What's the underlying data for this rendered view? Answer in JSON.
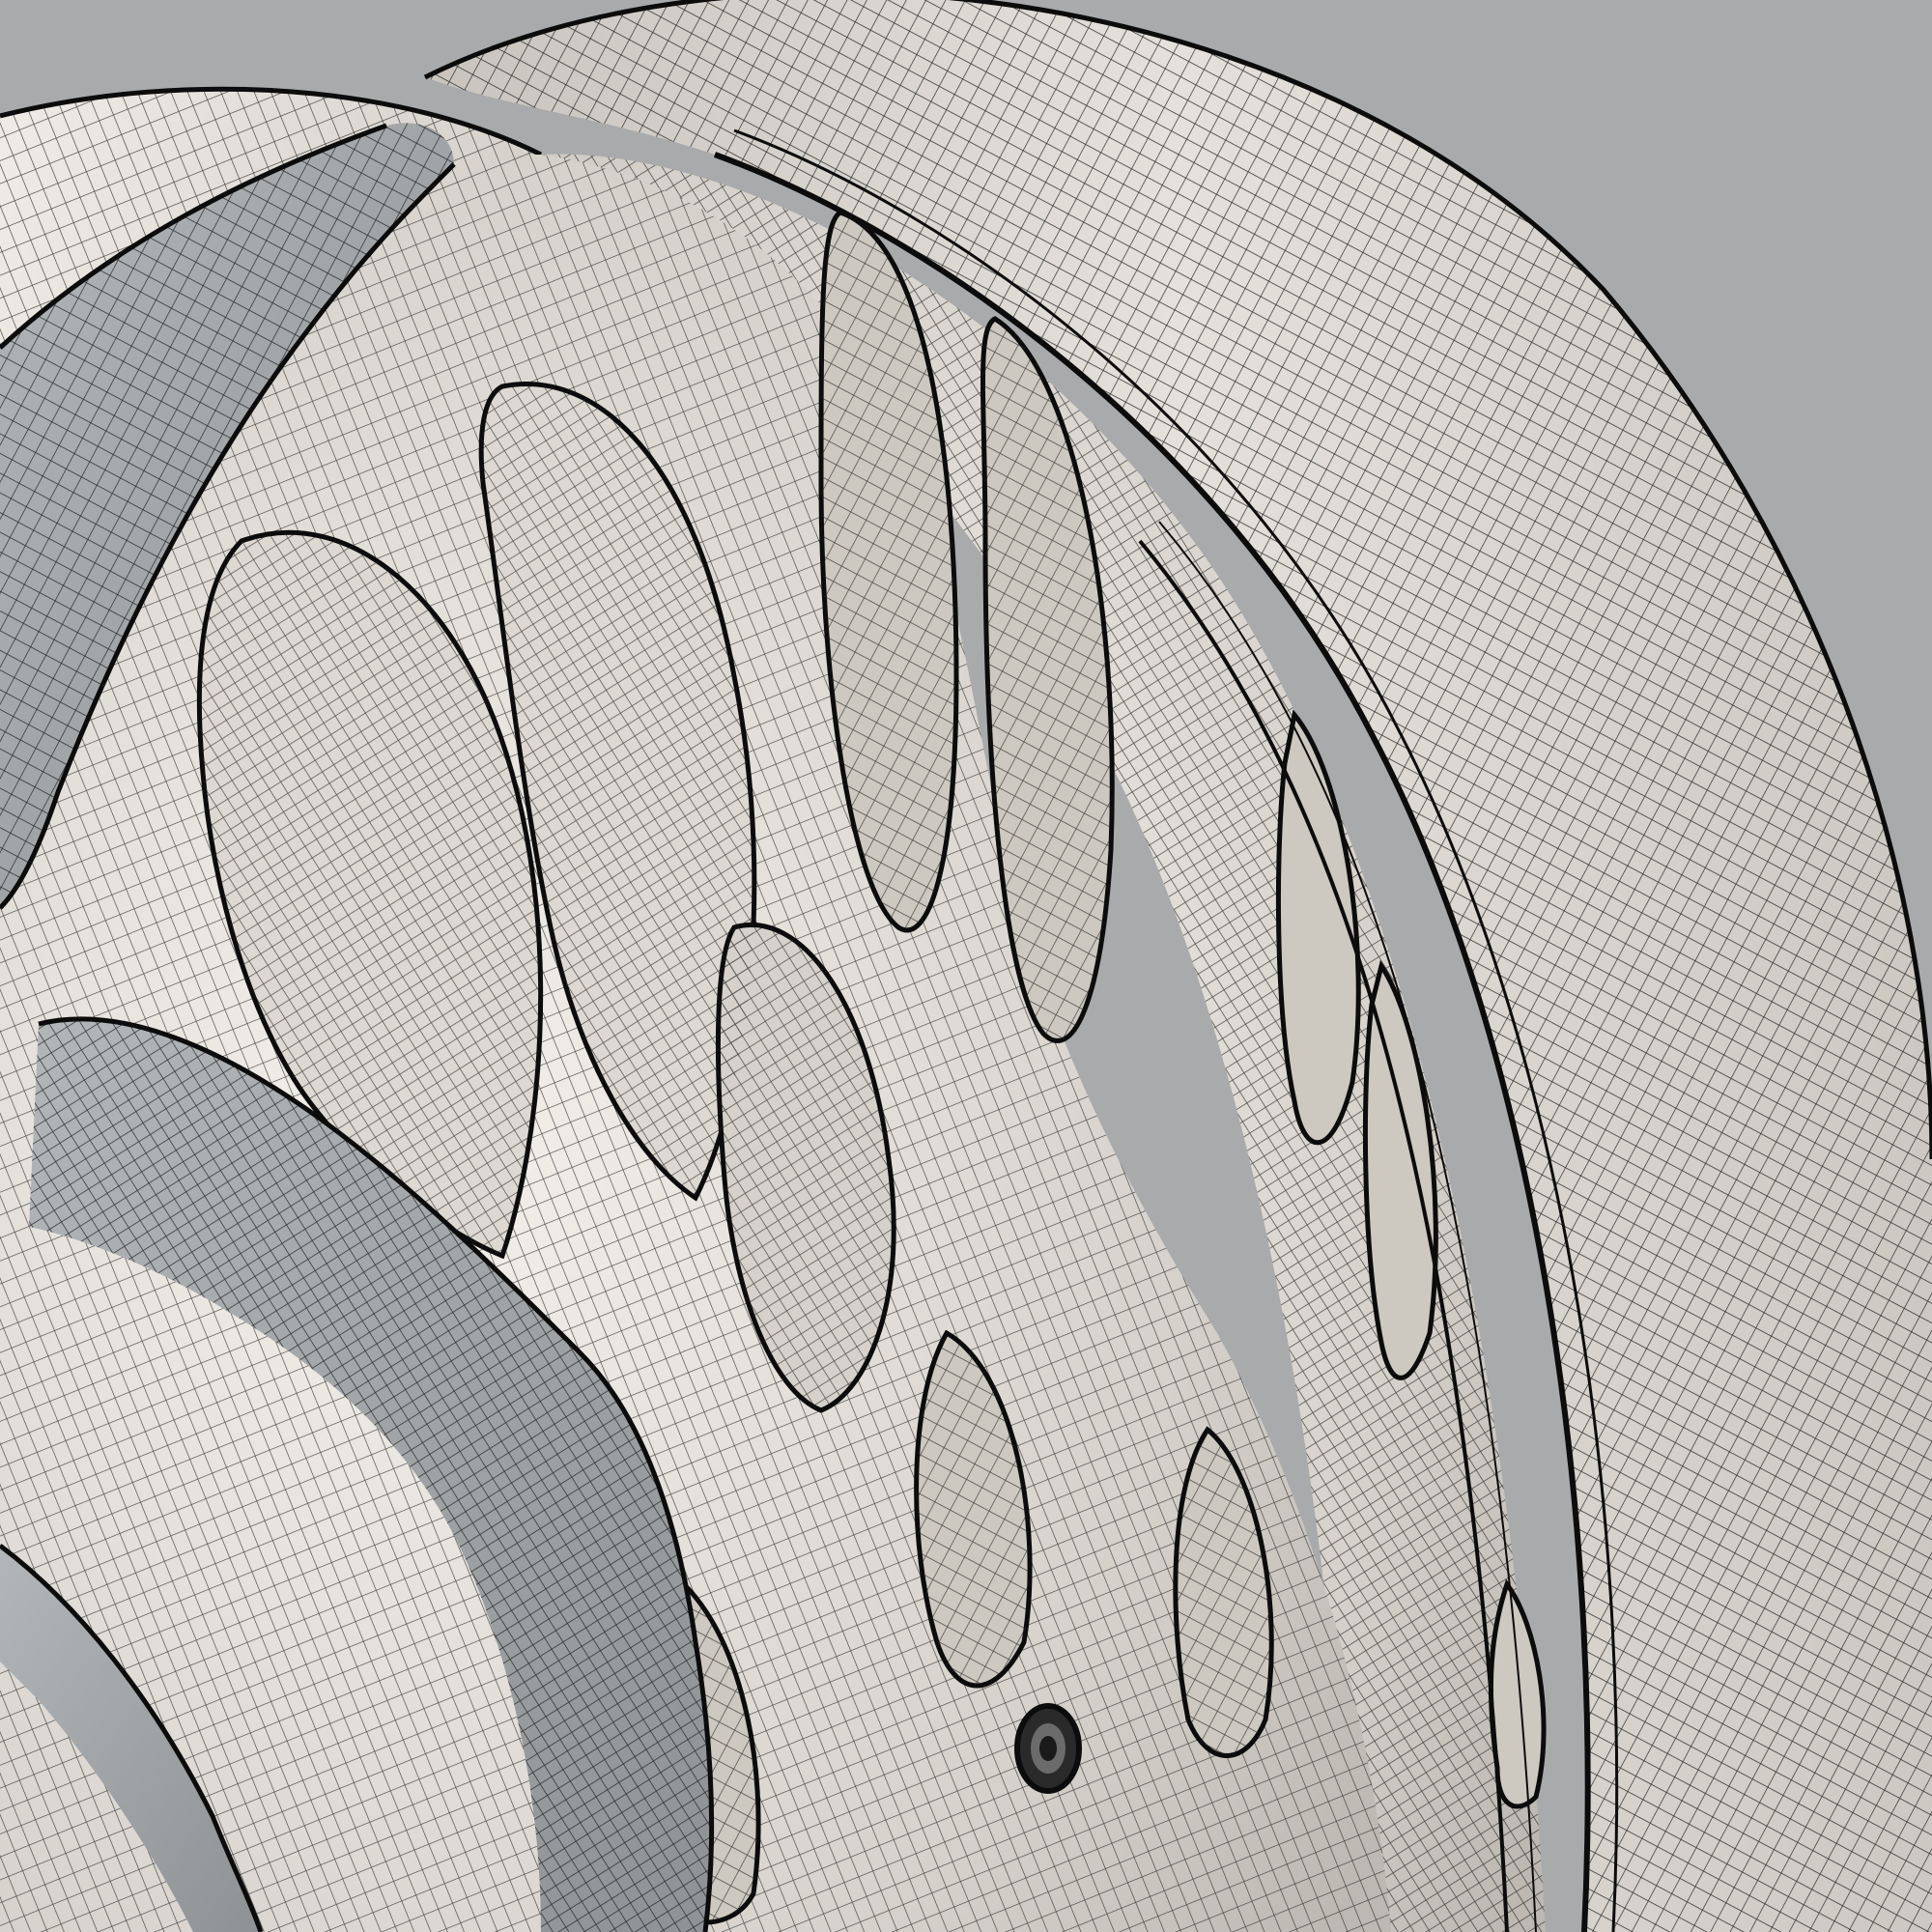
{
  "scene": {
    "subject": "wireframe-wheel-render",
    "colors": {
      "background": "#a9aaab",
      "surface_light": "#e6e2dc",
      "surface_mid": "#cfcac3",
      "surface_shadow": "#a8a39d",
      "wire": "#1c1c1c",
      "edge": "#0c0c0c",
      "spoke_face": "#9fa3a6"
    }
  }
}
